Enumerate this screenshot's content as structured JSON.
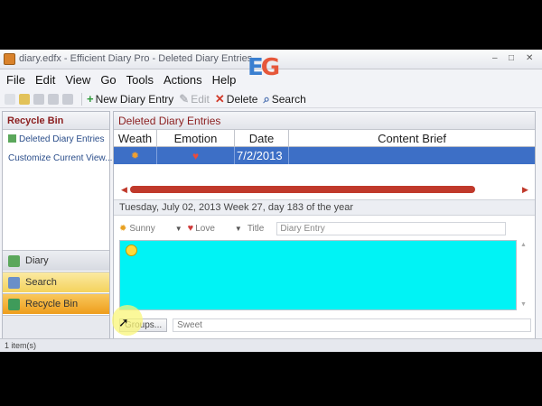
{
  "window": {
    "title": "diary.edfx - Efficient Diary Pro - Deleted Diary Entries",
    "controls": {
      "minimize": "–",
      "maximize": "□",
      "close": "✕"
    }
  },
  "menu": [
    "File",
    "Edit",
    "View",
    "Go",
    "Tools",
    "Actions",
    "Help"
  ],
  "toolbar": {
    "new_entry": "New Diary Entry",
    "edit": "Edit",
    "delete": "Delete",
    "search": "Search"
  },
  "left_pane": {
    "header": "Recycle Bin",
    "items": [
      "Deleted Diary Entries",
      "Customize Current View..."
    ],
    "nav": [
      "Diary",
      "Search",
      "Recycle Bin"
    ]
  },
  "main": {
    "header": "Deleted Diary Entries",
    "columns": [
      "Weath",
      "Emotion",
      "Date",
      "Content Brief"
    ],
    "row": {
      "date": "7/2/2013",
      "content": ""
    },
    "date_line": "Tuesday, July 02, 2013  Week 27, day 183 of the year",
    "weather": "Sunny",
    "emotion": "Love",
    "title_label": "Title",
    "title_value": "Diary Entry",
    "groups_button": "Groups...",
    "groups_value": "Sweet"
  },
  "status": "1 item(s)",
  "colors": {
    "accent": "#3d6fc6",
    "editor_bg": "#00f3f5",
    "header_text": "#8b1e1e",
    "scroll_red": "#c0392b"
  },
  "icons": [
    "app-icon",
    "logo",
    "new-icon",
    "delete-icon",
    "search-icon",
    "weather-icon",
    "heart-icon",
    "smiley-icon",
    "mouse-cursor"
  ]
}
